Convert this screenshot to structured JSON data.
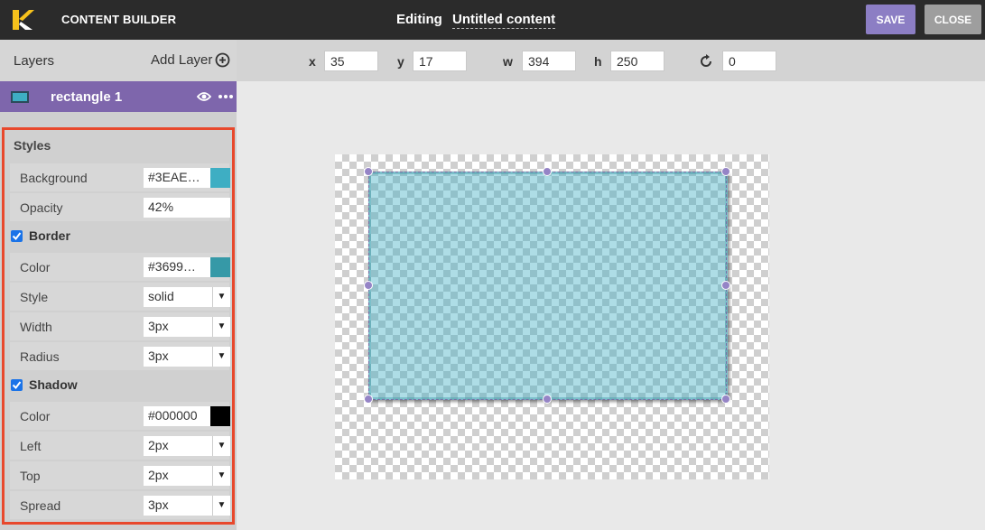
{
  "header": {
    "app_title": "CONTENT BUILDER",
    "editing_label": "Editing",
    "document_title": "Untitled content",
    "save_label": "SAVE",
    "close_label": "CLOSE",
    "logo_icon": "k-logo-icon"
  },
  "layers": {
    "title": "Layers",
    "add_label": "Add Layer",
    "items": [
      {
        "name": "rectangle 1",
        "thumb_color": "#3EAEC3"
      }
    ]
  },
  "toolbar": {
    "x_label": "x",
    "x_value": "35",
    "y_label": "y",
    "y_value": "17",
    "w_label": "w",
    "w_value": "394",
    "h_label": "h",
    "h_value": "250",
    "rotation_value": "0"
  },
  "styles": {
    "title": "Styles",
    "background_label": "Background",
    "background_value": "#3EAE…",
    "background_color": "#3EAEC3",
    "opacity_label": "Opacity",
    "opacity_value": "42%",
    "border_section": "Border",
    "border_enabled": true,
    "border_color_label": "Color",
    "border_color_value": "#3699…",
    "border_color": "#3699A7",
    "border_style_label": "Style",
    "border_style_value": "solid",
    "border_width_label": "Width",
    "border_width_value": "3px",
    "border_radius_label": "Radius",
    "border_radius_value": "3px",
    "shadow_section": "Shadow",
    "shadow_enabled": true,
    "shadow_color_label": "Color",
    "shadow_color_value": "#000000",
    "shadow_color": "#000000",
    "shadow_left_label": "Left",
    "shadow_left_value": "2px",
    "shadow_top_label": "Top",
    "shadow_top_value": "2px",
    "shadow_spread_label": "Spread",
    "shadow_spread_value": "3px"
  },
  "colors": {
    "accent": "#8C7EC4",
    "layer_selected": "#7E66AC",
    "highlight_border": "#E8482C"
  }
}
